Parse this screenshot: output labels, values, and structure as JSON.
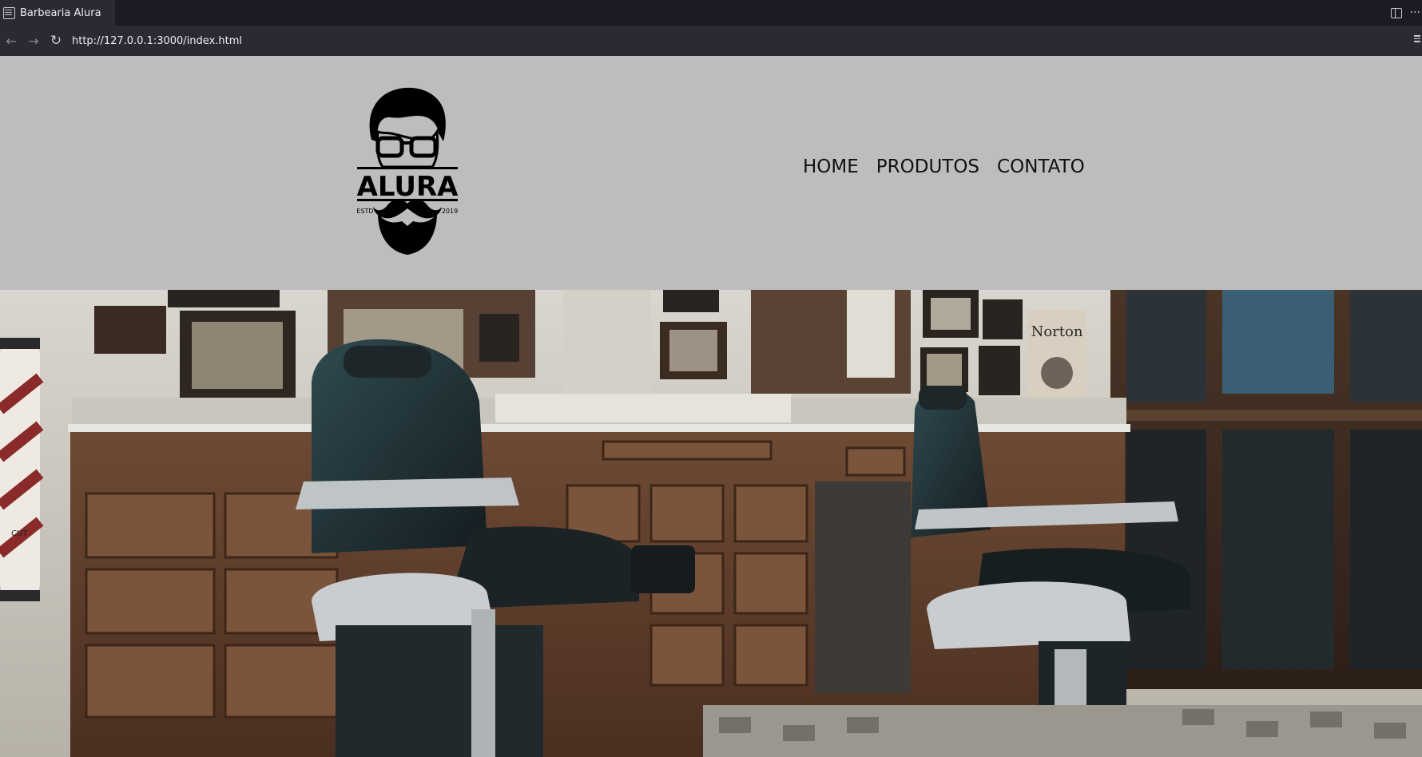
{
  "browser": {
    "tab_title": "Barbearia Alura",
    "url": "http://127.0.0.1:3000/index.html",
    "more_label": "···"
  },
  "header": {
    "logo": {
      "brand": "ALURA",
      "established_left": "ESTD",
      "established_right": "2019"
    },
    "nav": [
      {
        "label": "HOME"
      },
      {
        "label": "PRODUTOS"
      },
      {
        "label": "CONTATO"
      }
    ]
  },
  "hero": {
    "poster_text": "Norton",
    "pole_text": "CUT"
  },
  "colors": {
    "header_bg": "#bdbdbd",
    "nav_text": "#111111",
    "chrome_bg": "#1b1b24",
    "chrome_bar": "#2a2a35"
  }
}
